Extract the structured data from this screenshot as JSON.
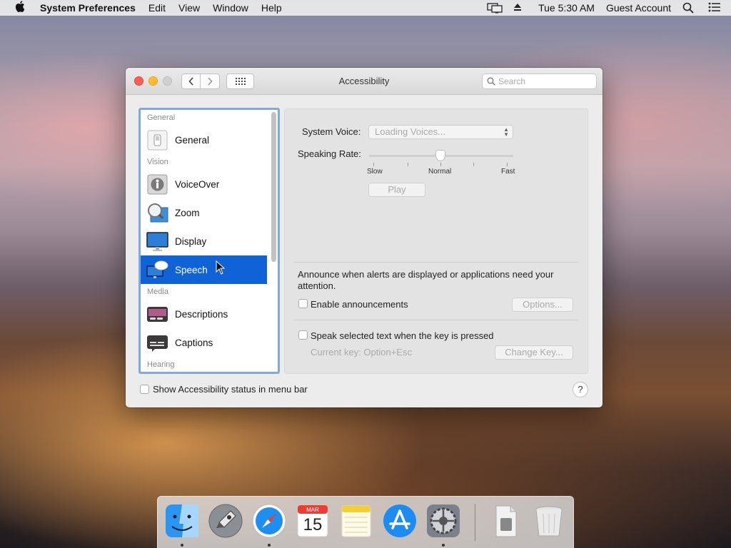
{
  "menubar": {
    "app_name": "System Preferences",
    "menus": [
      "Edit",
      "View",
      "Window",
      "Help"
    ],
    "clock": "Tue 5:30 AM",
    "user": "Guest Account"
  },
  "window": {
    "title": "Accessibility",
    "search_placeholder": "Search",
    "show_status_label": "Show Accessibility status in menu bar",
    "help_label": "?"
  },
  "sidebar": {
    "sections": {
      "general": "General",
      "vision": "Vision",
      "media": "Media",
      "hearing": "Hearing"
    },
    "items": {
      "general": "General",
      "voiceover": "VoiceOver",
      "zoom": "Zoom",
      "display": "Display",
      "speech": "Speech",
      "descriptions": "Descriptions",
      "captions": "Captions"
    },
    "selected": "Speech"
  },
  "speech": {
    "system_voice_label": "System Voice:",
    "system_voice_value": "Loading Voices...",
    "speaking_rate_label": "Speaking Rate:",
    "rate_slow": "Slow",
    "rate_normal": "Normal",
    "rate_fast": "Fast",
    "rate_value": 0.5,
    "play_label": "Play",
    "announce_text": "Announce when alerts are displayed or applications need your attention.",
    "enable_announcements_label": "Enable announcements",
    "options_label": "Options...",
    "speak_selected_label": "Speak selected text when the key is pressed",
    "current_key_text": "Current key: Option+Esc",
    "change_key_label": "Change Key..."
  },
  "dock": {
    "apps": [
      "finder-icon",
      "launchpad-icon",
      "safari-icon",
      "calendar-icon",
      "notes-icon",
      "app-store-icon",
      "system-preferences-icon",
      "document-icon",
      "trash-icon"
    ],
    "calendar_month": "MAR",
    "calendar_day": "15"
  },
  "colors": {
    "selection": "#0f63d6",
    "close": "#fd5f57",
    "minimize": "#febc2e"
  }
}
